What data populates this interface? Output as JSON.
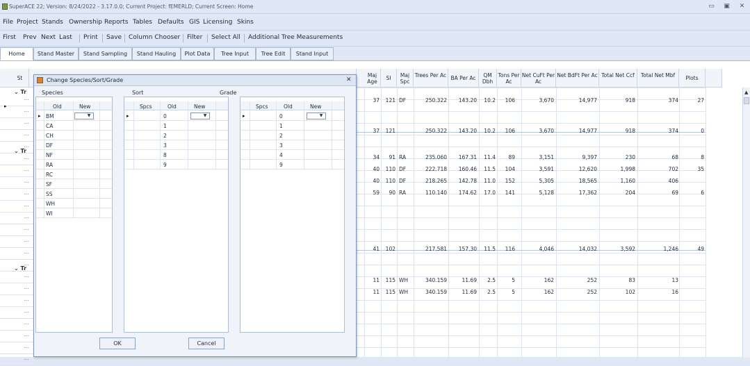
{
  "title": "SuperACE 22; Version: 8/24/2022 - 3.17.0.0; Current Project: fEMERLD; Current Screen: Home",
  "menu": [
    "File",
    "Project",
    "Stands",
    "Ownership",
    "Reports",
    "Tables",
    "Defaults",
    "GIS",
    "Licensing",
    "Skins"
  ],
  "toolbar": [
    "First",
    "Prev",
    "Next",
    "Last",
    "Print",
    "Save",
    "Column Chooser",
    "Filter",
    "Select All",
    "Additional Tree Measurements"
  ],
  "tabs": [
    "Home",
    "Stand Master",
    "Stand Sampling",
    "Stand Hauling",
    "Plot Data",
    "Tree Input",
    "Tree Edit",
    "Stand Input"
  ],
  "left_col_header": "St",
  "group_label": "Tr",
  "columns": [
    "Maj Age",
    "SI",
    "Maj Spc",
    "Trees Per Ac",
    "BA Per Ac",
    "QM Dbh",
    "Tons Per Ac",
    "Net CuFt Per Ac",
    "Net BdFt Per Ac",
    "Total Net Ccf",
    "Total Net Mbf",
    "Plots"
  ],
  "rows": [
    [
      "37",
      "121",
      "DF",
      "250.322",
      "143.20",
      "10.2",
      "106",
      "3,670",
      "14,977",
      "918",
      "374",
      "27"
    ],
    [
      "37",
      "121",
      "",
      "250.322",
      "143.20",
      "10.2",
      "106",
      "3,670",
      "14,977",
      "918",
      "374",
      "0"
    ],
    [
      "34",
      "91",
      "RA",
      "235.060",
      "167.31",
      "11.4",
      "89",
      "3,151",
      "9,397",
      "230",
      "68",
      "8"
    ],
    [
      "40",
      "110",
      "DF",
      "222.718",
      "160.46",
      "11.5",
      "104",
      "3,591",
      "12,620",
      "1,998",
      "702",
      "35"
    ],
    [
      "40",
      "110",
      "DF",
      "218.265",
      "142.78",
      "11.0",
      "152",
      "5,305",
      "18,565",
      "1,160",
      "406",
      ""
    ],
    [
      "59",
      "90",
      "RA",
      "110.140",
      "174.62",
      "17.0",
      "141",
      "5,128",
      "17,362",
      "204",
      "69",
      "6"
    ],
    [
      "41",
      "102",
      "",
      "217.581",
      "157.30",
      "11.5",
      "116",
      "4,046",
      "14,032",
      "3,592",
      "1,246",
      "49"
    ],
    [
      "11",
      "115",
      "WH",
      "340.159",
      "11.69",
      "2.5",
      "5",
      "162",
      "252",
      "83",
      "13",
      ""
    ],
    [
      "11",
      "115",
      "WH",
      "340.159",
      "11.69",
      "2.5",
      "5",
      "162",
      "252",
      "102",
      "16",
      ""
    ]
  ],
  "dialog": {
    "title": "Change Species/Sort/Grade",
    "species_label": "Species",
    "sort_label": "Sort",
    "grade_label": "Grade",
    "species_headers": [
      "Old",
      "New"
    ],
    "species_old": [
      "BM",
      "CA",
      "CH",
      "DF",
      "NF",
      "RA",
      "RC",
      "SF",
      "SS",
      "WH",
      "WI"
    ],
    "sort_headers": [
      "Spcs",
      "Old",
      "New"
    ],
    "sort_old": [
      "0",
      "1",
      "2",
      "3",
      "8",
      "9"
    ],
    "grade_headers": [
      "Spcs",
      "Old",
      "New"
    ],
    "grade_old": [
      "0",
      "1",
      "2",
      "3",
      "4",
      "9"
    ],
    "ok": "OK",
    "cancel": "Cancel",
    "close": "✕"
  },
  "row_dots": "..."
}
